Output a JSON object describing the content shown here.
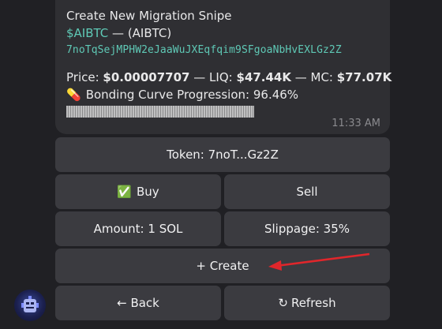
{
  "message": {
    "title": "Create New Migration Snipe",
    "cashtag": "$AIBTC",
    "name_suffix": " — (AIBTC)",
    "address": "7noTqSejMPHW2eJaaWuJXEqfqim9SFgoaNbHvEXLGz2Z",
    "price_label": "Price: ",
    "price_value": "$0.00007707",
    "liq_label": " — LIQ: ",
    "liq_value": "$47.44K",
    "mc_label": " — MC: ",
    "mc_value": "$77.07K",
    "bonding_emoji": "💊",
    "bonding_text": "Bonding Curve Progression: 96.46%",
    "bonding_progress": 0.9646,
    "time": "11:33 AM"
  },
  "buttons": {
    "token": "Token: 7noT...Gz2Z",
    "buy_emoji": "✅",
    "buy": "Buy",
    "sell": "Sell",
    "amount": "Amount: 1 SOL",
    "slippage": "Slippage: 35%",
    "create": "+ Create",
    "back": "← Back",
    "refresh_icon": "↻",
    "refresh": "Refresh"
  },
  "colors": {
    "background": "#202024",
    "bubble": "#2f2f33",
    "button": "#3b3b40",
    "accent_teal": "#5fc9b6",
    "annotation_arrow": "#e0262b"
  }
}
